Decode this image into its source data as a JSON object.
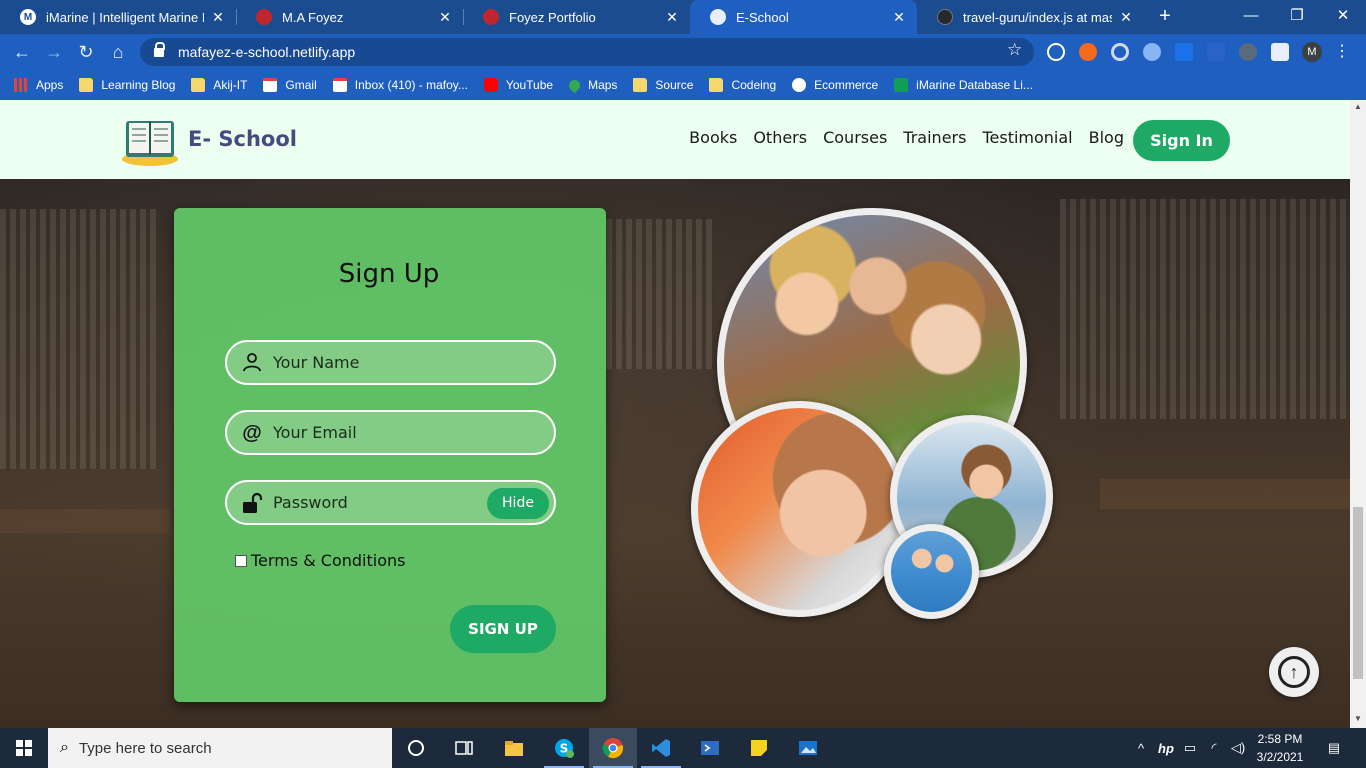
{
  "browser": {
    "tabs": [
      {
        "title": "iMarine | Intelligent Marine Ma",
        "active": false
      },
      {
        "title": "M.A Foyez",
        "active": false
      },
      {
        "title": "Foyez Portfolio",
        "active": false
      },
      {
        "title": "E-School",
        "active": true
      },
      {
        "title": "travel-guru/index.js at master",
        "active": false
      }
    ],
    "url": "mafayez-e-school.netlify.app",
    "profile_initial": "M",
    "bookmarks": [
      "Apps",
      "Learning Blog",
      "Akij-IT",
      "Gmail",
      "Inbox (410) - mafoy...",
      "YouTube",
      "Maps",
      "Source",
      "Codeing",
      "Ecommerce",
      "iMarine Database Li..."
    ]
  },
  "site": {
    "brand": "E- School",
    "menu": [
      "Books",
      "Others",
      "Courses",
      "Trainers",
      "Testimonial",
      "Blog"
    ],
    "signin_label": "Sign In",
    "accent": "#1eaa64",
    "nav_bg": "#ecfff1"
  },
  "form": {
    "title": "Sign Up",
    "name_placeholder": "Your Name",
    "email_placeholder": "Your Email",
    "password_placeholder": "Password",
    "hide_label": "Hide",
    "terms_label": "Terms & Conditions",
    "submit_label": "SIGN UP",
    "card_color": "#62c868"
  },
  "taskbar": {
    "search_placeholder": "Type here to search",
    "time": "2:58 PM",
    "date": "3/2/2021"
  }
}
